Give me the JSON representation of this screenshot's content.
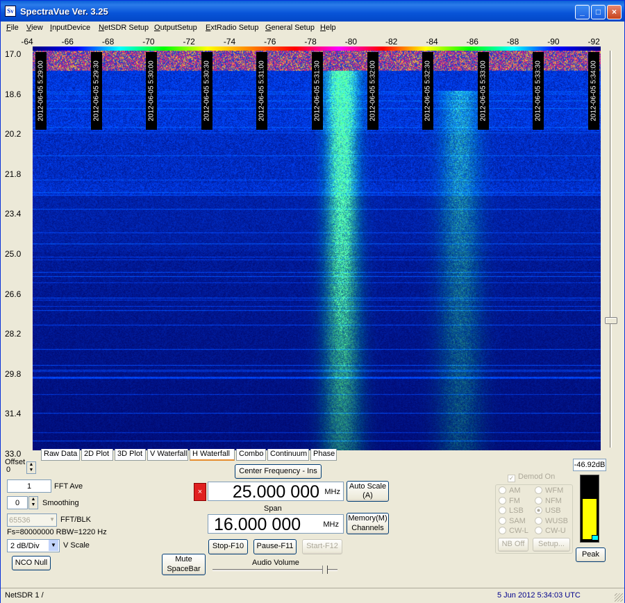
{
  "window": {
    "title": "SpectraVue Ver. 3.25",
    "icon": "Sv",
    "minimize": "_",
    "maximize": "□",
    "close": "×"
  },
  "menu": [
    {
      "label": "File",
      "u": "F",
      "rest": "ile"
    },
    {
      "label": "View",
      "u": "V",
      "rest": "iew"
    },
    {
      "label": "InputDevice",
      "u": "I",
      "rest": "nputDevice"
    },
    {
      "label": "NetSDR Setup",
      "u": "N",
      "rest": "etSDR Setup"
    },
    {
      "label": "OutputSetup",
      "u": "O",
      "rest": "utputSetup"
    },
    {
      "label": "ExtRadio Setup",
      "u": "E",
      "rest": "xtRadio Setup"
    },
    {
      "label": "General Setup",
      "u": "G",
      "rest": "eneral Setup"
    },
    {
      "label": "Help",
      "u": "H",
      "rest": "elp"
    }
  ],
  "freq_axis": [
    "-64",
    "-66",
    "-68",
    "-70",
    "-72",
    "-74",
    "-76",
    "-78",
    "-80",
    "-82",
    "-84",
    "-86",
    "-88",
    "-90",
    "-92"
  ],
  "time_axis": [
    "17.0",
    "18.6",
    "20.2",
    "21.8",
    "23.4",
    "25.0",
    "26.6",
    "28.2",
    "29.8",
    "31.4",
    "33.0"
  ],
  "timestamps": [
    "2012-06-05 5:29:00",
    "2012-06-05 5:29:30",
    "2012-06-05 5:30:00",
    "2012-06-05 5:30:30",
    "2012-06-05 5:31:00",
    "2012-06-05 5:31:30",
    "2012-06-05 5:32:00",
    "2012-06-05 5:32:30",
    "2012-06-05 5:33:00",
    "2012-06-05 5:33:30",
    "2012-06-05 5:34:00"
  ],
  "tabs": [
    "Raw Data",
    "2D Plot",
    "3D Plot",
    "V Waterfall",
    "H Waterfall",
    "Combo",
    "Continuum",
    "Phase"
  ],
  "active_tab": "H Waterfall",
  "controls": {
    "offset_label": "Offset",
    "offset_value": "0",
    "fft_ave_value": "1",
    "fft_ave_label": "FFT Ave",
    "smoothing_value": "0",
    "smoothing_label": "Smoothing",
    "fft_blk_value": "65536",
    "fft_blk_label": "FFT/BLK",
    "fs_info": "Fs=80000000 RBW=1220 Hz",
    "vscale_value": "2 dB/Div",
    "vscale_label": "V Scale",
    "nco_null": "NCO Null",
    "mute": "Mute\nSpaceBar",
    "center_freq_button": "Center Frequency - Ins",
    "center_freq_value": "25.000 000",
    "center_freq_unit": "MHz",
    "auto_scale": "Auto Scale\n(A)",
    "span_label": "Span",
    "span_value": "16.000 000",
    "span_unit": "MHz",
    "memory": "Memory(M)\nChannels",
    "stop": "Stop-F10",
    "pause": "Pause-F11",
    "start": "Start-F12",
    "audio_volume": "Audio Volume",
    "audio_volume_level": 0.9,
    "db_readout": "-46.92dB",
    "peak": "Peak",
    "demod_on": "Demod On",
    "nb_off": "NB Off",
    "setup": "Setup...",
    "meter_level": 0.72
  },
  "demod_modes": [
    {
      "label": "AM",
      "selected": false
    },
    {
      "label": "WFM",
      "selected": false
    },
    {
      "label": "FM",
      "selected": false
    },
    {
      "label": "NFM",
      "selected": false
    },
    {
      "label": "LSB",
      "selected": false
    },
    {
      "label": "USB",
      "selected": true
    },
    {
      "label": "SAM",
      "selected": false
    },
    {
      "label": "WUSB",
      "selected": false
    },
    {
      "label": "CW-L",
      "selected": false
    },
    {
      "label": "CW-U",
      "selected": false
    }
  ],
  "status": {
    "left": "NetSDR 1  /",
    "right": "5 Jun 2012  5:34:03 UTC"
  },
  "colors": {
    "waterfall_bg": "#0a1a7a",
    "signal": "#40ff90",
    "status_date": "#00008b",
    "meter": "#ffff00"
  }
}
